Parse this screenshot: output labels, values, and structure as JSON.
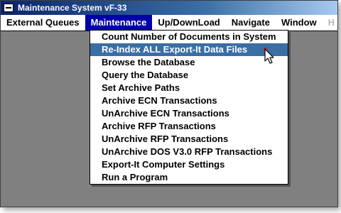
{
  "window": {
    "title": "Maintenance System vF-33"
  },
  "menubar": [
    {
      "label": "External Queues",
      "active": false
    },
    {
      "label": "Maintenance",
      "active": true
    },
    {
      "label": "Up/DownLoad",
      "active": false
    },
    {
      "label": "Navigate",
      "active": false
    },
    {
      "label": "Window",
      "active": false
    },
    {
      "label": "H",
      "active": false
    }
  ],
  "maintenance_menu": {
    "items": [
      "Count Number of Documents in System",
      "Re-Index ALL Export-It Data Files",
      "Browse the Database",
      "Query the Database",
      "Set Archive Paths",
      "Archive ECN Transactions",
      "UnArchive ECN Transactions",
      "Archive RFP Transactions",
      "UnArchive RFP Transactions",
      "UnArchive DOS V3.0 RFP Transactions",
      "Export-It Computer Settings",
      "Run a Program"
    ],
    "highlighted_index": 1
  },
  "colors": {
    "menu_active": "#0000a8",
    "item_highlight": "#3a6ea5",
    "pointer_dot": "#e01010"
  },
  "icons": [
    "system-menu-icon",
    "mouse-pointer-icon"
  ]
}
